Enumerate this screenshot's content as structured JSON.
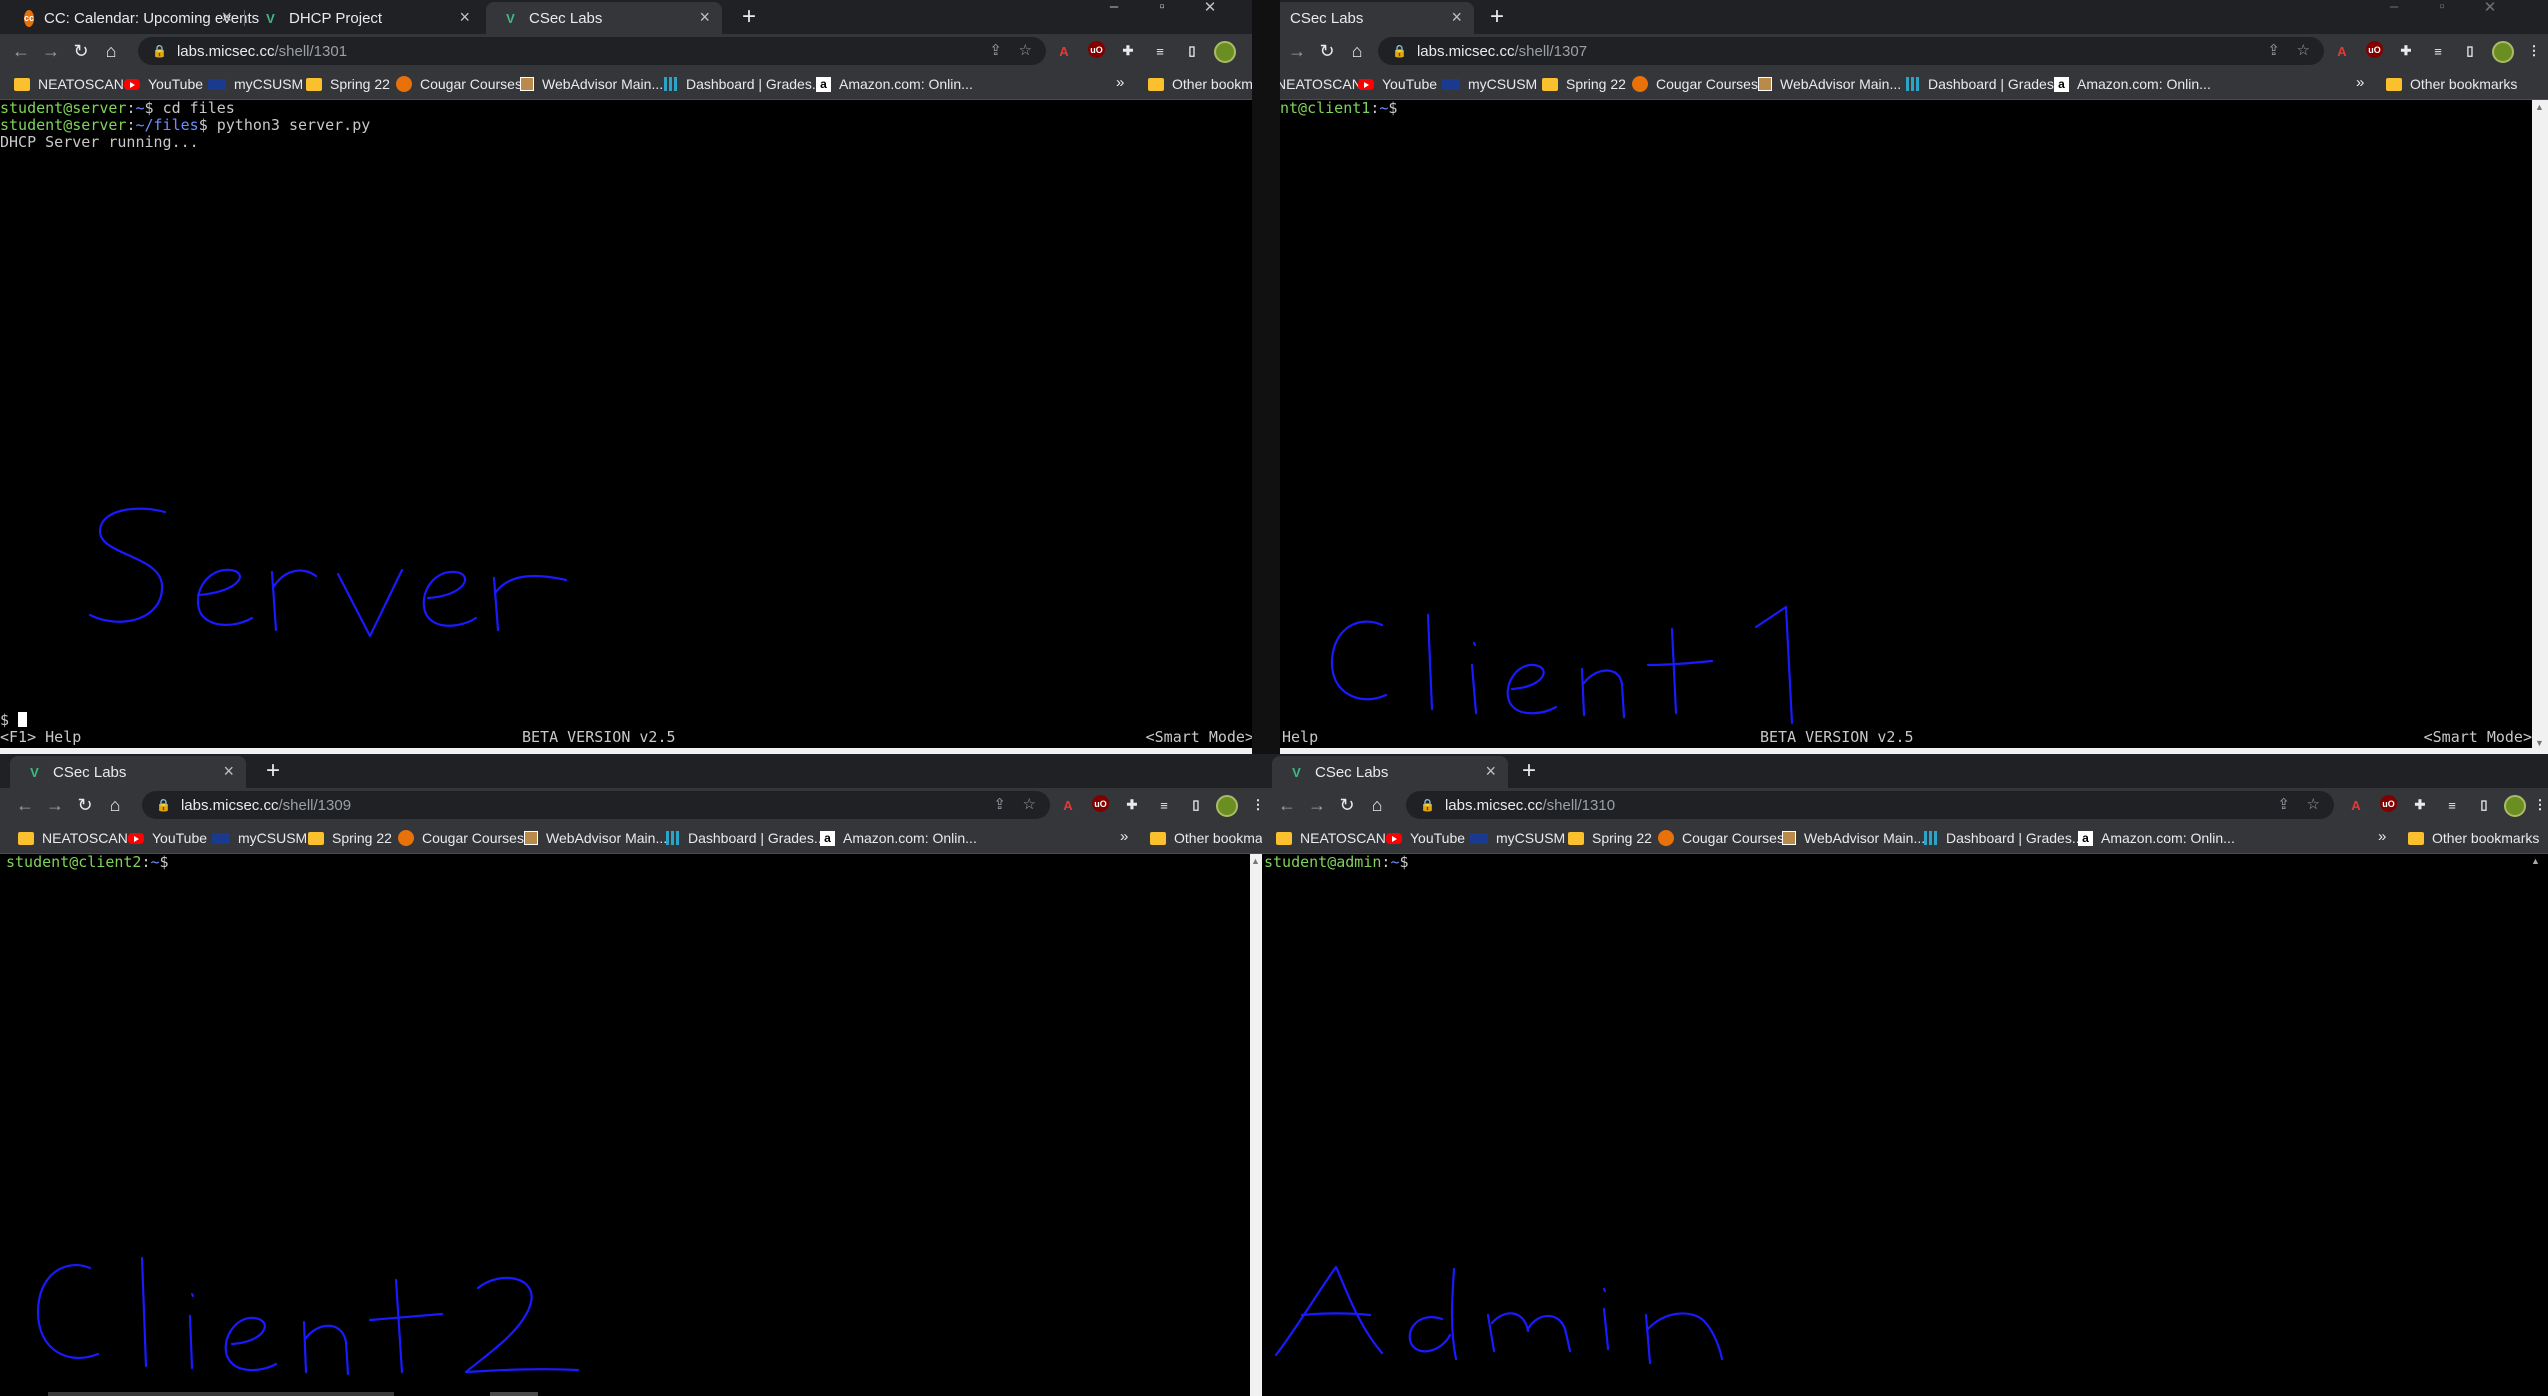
{
  "windows": {
    "server": {
      "tabs": [
        {
          "title": "CC: Calendar: Upcoming events",
          "favicon": "cc-logo-icon"
        },
        {
          "title": "DHCP Project",
          "favicon": "vue-logo-icon"
        },
        {
          "title": "CSec Labs",
          "favicon": "vue-logo-icon",
          "active": true
        }
      ],
      "url_host": "labs.micsec.cc",
      "url_path": "/shell/1301",
      "terminal_lines": [
        {
          "user": "student@server",
          "path": "~",
          "cmd": "cd files"
        },
        {
          "user": "student@server",
          "path": "~/files",
          "cmd": "python3 server.py"
        }
      ],
      "output": "DHCP Server running...",
      "input_prompt": "$ ",
      "status_help": "<F1> Help",
      "status_version": "BETA VERSION v2.5",
      "status_mode": "<Smart Mode>",
      "handwritten_label": "Server"
    },
    "client1": {
      "tabs": [
        {
          "title": "CSec Labs",
          "favicon": "vue-logo-icon",
          "active": true
        }
      ],
      "url_host": "labs.micsec.cc",
      "url_path": "/shell/1307",
      "prompt_visible": "nt@client1",
      "prompt_path": "~",
      "status_help": "Help",
      "status_version": "BETA VERSION v2.5",
      "status_mode": "<Smart Mode>",
      "handwritten_label": "Client1"
    },
    "client2": {
      "tabs": [
        {
          "title": "CSec Labs",
          "favicon": "vue-logo-icon",
          "active": true
        }
      ],
      "url_host": "labs.micsec.cc",
      "url_path": "/shell/1309",
      "prompt_user": "student@client2",
      "prompt_path": "~",
      "handwritten_label": "Client2"
    },
    "admin": {
      "tabs": [
        {
          "title": "CSec Labs",
          "favicon": "vue-logo-icon",
          "active": true
        }
      ],
      "url_host": "labs.micsec.cc",
      "url_path": "/shell/1310",
      "prompt_user": "student@admin",
      "prompt_path": "~",
      "handwritten_label": "Admin"
    }
  },
  "bookmarks": [
    {
      "label": "NEATOSCAN",
      "icon": "folder-icon"
    },
    {
      "label": "YouTube",
      "icon": "youtube-icon"
    },
    {
      "label": "myCSUSM",
      "icon": "csusm-icon"
    },
    {
      "label": "Spring 22",
      "icon": "folder-icon"
    },
    {
      "label": "Cougar Courses",
      "icon": "cc-logo-icon"
    },
    {
      "label": "WebAdvisor Main...",
      "icon": "webadvisor-icon"
    },
    {
      "label": "Dashboard | Grades...",
      "icon": "dashboard-icon"
    },
    {
      "label": "Amazon.com: Onlin...",
      "icon": "amazon-icon"
    }
  ],
  "other_bookmarks": "Other bookmarks",
  "colors": {
    "prompt_green": "#7fd35a",
    "prompt_blue": "#6b8fff",
    "ink": "#1a1aff",
    "chrome_dark": "#202124",
    "chrome_toolbar": "#35363a"
  }
}
